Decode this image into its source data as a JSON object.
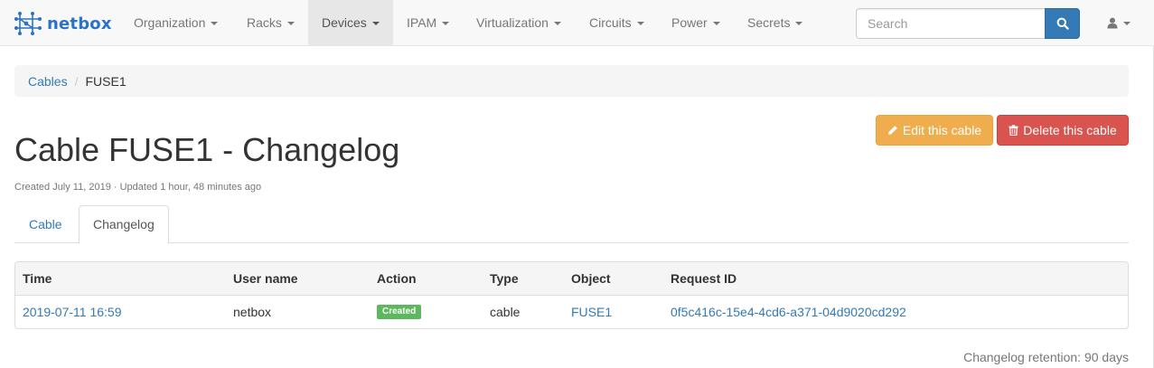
{
  "brand": {
    "name": "netbox"
  },
  "nav": {
    "items": [
      {
        "label": "Organization"
      },
      {
        "label": "Racks"
      },
      {
        "label": "Devices",
        "active": true
      },
      {
        "label": "IPAM"
      },
      {
        "label": "Virtualization"
      },
      {
        "label": "Circuits"
      },
      {
        "label": "Power"
      },
      {
        "label": "Secrets"
      }
    ],
    "search_placeholder": "Search",
    "search_icon": "search-icon",
    "user_icon": "user-icon"
  },
  "breadcrumb": {
    "parent": "Cables",
    "separator": "/",
    "current": "FUSE1"
  },
  "actions": {
    "edit_label": "Edit this cable",
    "edit_icon": "pencil-icon",
    "delete_label": "Delete this cable",
    "delete_icon": "trash-icon"
  },
  "page": {
    "title": "Cable FUSE1 - Changelog",
    "meta": "Created July 11, 2019 · Updated 1 hour, 48 minutes ago"
  },
  "tabs": [
    {
      "label": "Cable",
      "active": false
    },
    {
      "label": "Changelog",
      "active": true
    }
  ],
  "table": {
    "columns": [
      "Time",
      "User name",
      "Action",
      "Type",
      "Object",
      "Request ID"
    ],
    "rows": [
      {
        "time": "2019-07-11 16:59",
        "user": "netbox",
        "action": "Created",
        "type": "cable",
        "object": "FUSE1",
        "request_id": "0f5c416c-15e4-4cd6-a371-04d9020cd292"
      }
    ]
  },
  "retention": "Changelog retention: 90 days",
  "colors": {
    "brand": "#2b72c8",
    "link": "#337ab7",
    "warning": "#f0ad4e",
    "danger": "#d9534f",
    "success": "#5cb85c"
  }
}
